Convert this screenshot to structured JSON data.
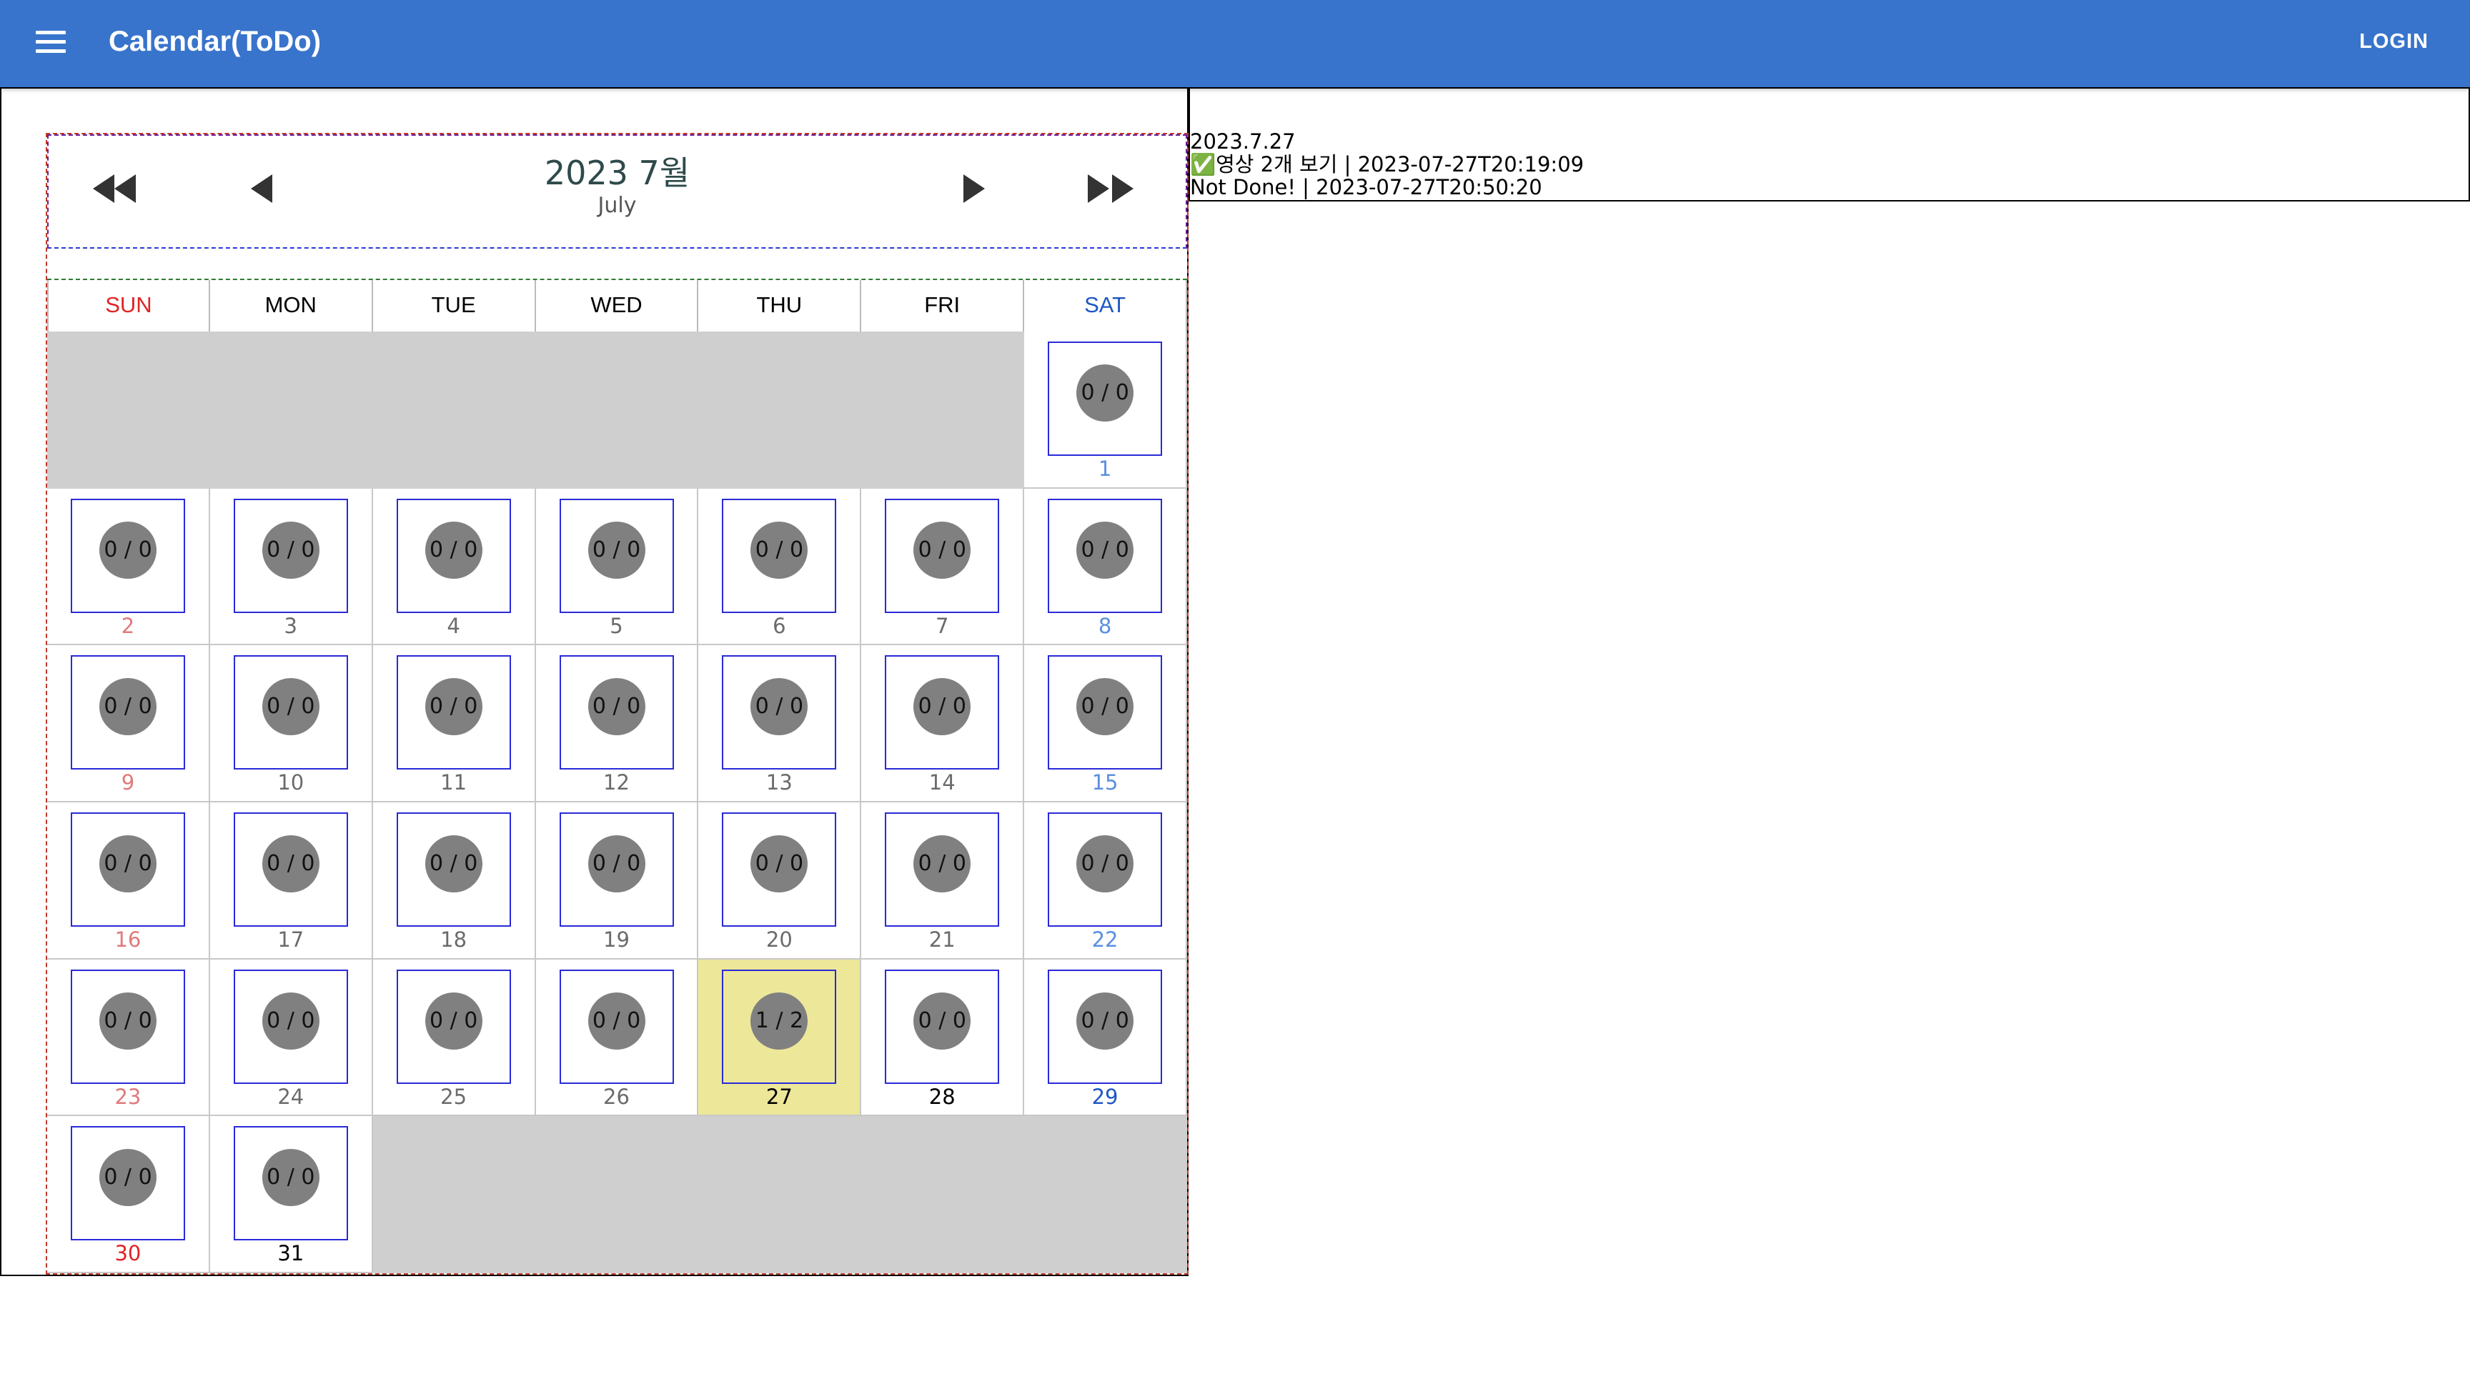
{
  "app": {
    "title": "Calendar(ToDo)",
    "login_label": "LOGIN"
  },
  "calendar": {
    "title": "2023 7월",
    "subtitle": "July",
    "weekdays": [
      "SUN",
      "MON",
      "TUE",
      "WED",
      "THU",
      "FRI",
      "SAT"
    ],
    "weekday_colors": [
      "#e02424",
      "#000000",
      "#000000",
      "#000000",
      "#000000",
      "#000000",
      "#1f57c3"
    ],
    "leading_blank_days": 6,
    "today": 27,
    "days": [
      {
        "day": "1",
        "count": "0 / 0"
      },
      {
        "day": "2",
        "count": "0 / 0"
      },
      {
        "day": "3",
        "count": "0 / 0"
      },
      {
        "day": "4",
        "count": "0 / 0"
      },
      {
        "day": "5",
        "count": "0 / 0"
      },
      {
        "day": "6",
        "count": "0 / 0"
      },
      {
        "day": "7",
        "count": "0 / 0"
      },
      {
        "day": "8",
        "count": "0 / 0"
      },
      {
        "day": "9",
        "count": "0 / 0"
      },
      {
        "day": "10",
        "count": "0 / 0"
      },
      {
        "day": "11",
        "count": "0 / 0"
      },
      {
        "day": "12",
        "count": "0 / 0"
      },
      {
        "day": "13",
        "count": "0 / 0"
      },
      {
        "day": "14",
        "count": "0 / 0"
      },
      {
        "day": "15",
        "count": "0 / 0"
      },
      {
        "day": "16",
        "count": "0 / 0"
      },
      {
        "day": "17",
        "count": "0 / 0"
      },
      {
        "day": "18",
        "count": "0 / 0"
      },
      {
        "day": "19",
        "count": "0 / 0"
      },
      {
        "day": "20",
        "count": "0 / 0"
      },
      {
        "day": "21",
        "count": "0 / 0"
      },
      {
        "day": "22",
        "count": "0 / 0"
      },
      {
        "day": "23",
        "count": "0 / 0"
      },
      {
        "day": "24",
        "count": "0 / 0"
      },
      {
        "day": "25",
        "count": "0 / 0"
      },
      {
        "day": "26",
        "count": "0 / 0"
      },
      {
        "day": "27",
        "count": "1 / 2"
      },
      {
        "day": "28",
        "count": "0 / 0"
      },
      {
        "day": "29",
        "count": "0 / 0"
      },
      {
        "day": "30",
        "count": "0 / 0"
      },
      {
        "day": "31",
        "count": "0 / 0"
      }
    ],
    "today_highlight_color": "#ede79a"
  },
  "detail": {
    "date": "2023.7.27",
    "items": [
      "✅영상 2개 보기 | 2023-07-27T20:19:09",
      "Not Done! | 2023-07-27T20:50:20"
    ]
  },
  "colors": {
    "appbar": "#3874cb",
    "day_box_border": "#2a2ad8",
    "badge": "#808080",
    "empty_cell": "#cfcfcf"
  }
}
